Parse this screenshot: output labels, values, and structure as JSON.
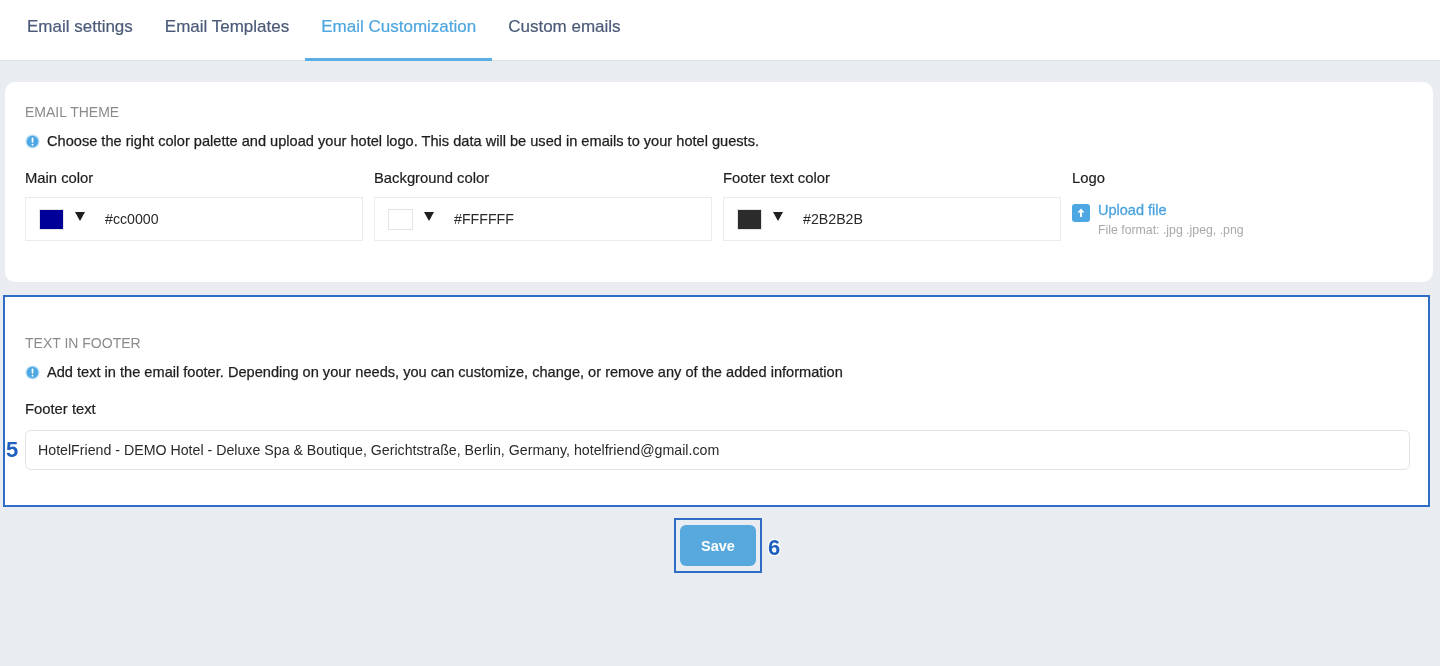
{
  "tabs": [
    {
      "label": "Email settings",
      "selected": false
    },
    {
      "label": "Email Templates",
      "selected": false
    },
    {
      "label": "Email Customization",
      "selected": true
    },
    {
      "label": "Custom emails",
      "selected": false
    }
  ],
  "theme_section": {
    "heading": "EMAIL THEME",
    "info": "Choose the right color palette and upload your hotel logo. This data will be used in emails to your hotel guests.",
    "color_fields": [
      {
        "label": "Main color",
        "color": "#000099",
        "value": "#cc0000"
      },
      {
        "label": "Background color",
        "color": "#ffffff",
        "value": "#FFFFFF"
      },
      {
        "label": "Footer text color",
        "color": "#2b2b2b",
        "value": "#2B2B2B"
      }
    ],
    "logo": {
      "label": "Logo",
      "upload_link": "Upload file",
      "hint": "File format: .jpg .jpeg, .png"
    }
  },
  "footer_section": {
    "highlighted": true,
    "callout": "5",
    "heading": "TEXT IN FOOTER",
    "info": "Add text in the email footer. Depending on your needs, you can customize, change, or remove any of the added information",
    "field_label": "Footer text",
    "field_value": "HotelFriend - DEMO Hotel - Deluxe Spa & Boutique, Gerichtstraße, Berlin, Germany, hotelfriend@gmail.com"
  },
  "save_button": {
    "label": "Save",
    "highlighted": true,
    "callout": "6"
  }
}
